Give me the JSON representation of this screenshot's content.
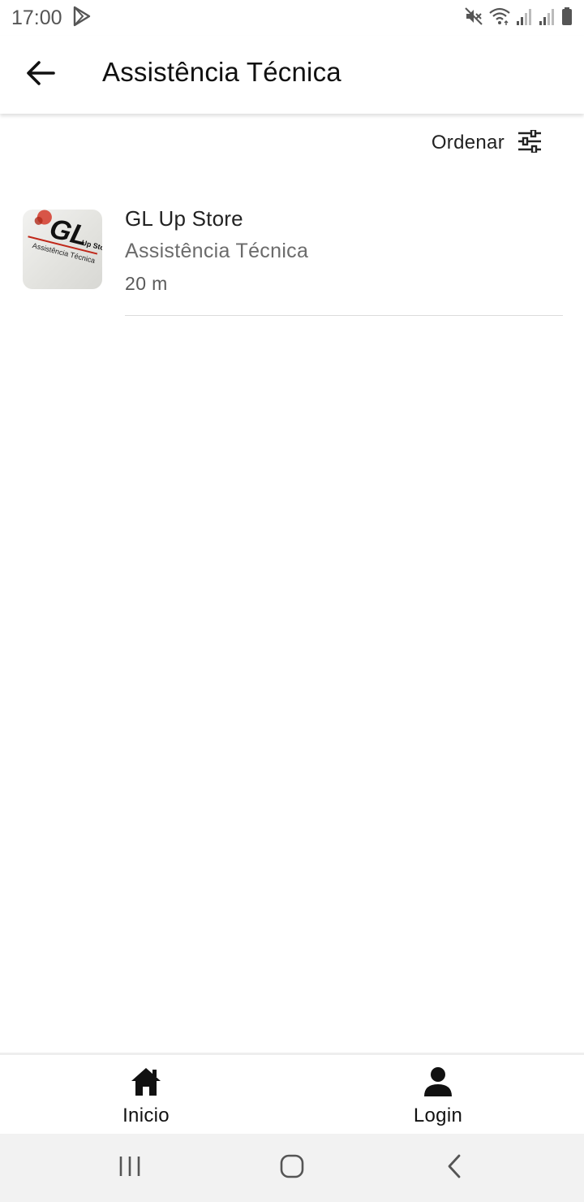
{
  "status_bar": {
    "time": "17:00",
    "icons": [
      "play-store-icon",
      "mute-icon",
      "wifi-icon",
      "signal-icon",
      "signal-icon",
      "battery-icon"
    ]
  },
  "app_bar": {
    "title": "Assistência Técnica",
    "back_icon": "arrow-left-icon"
  },
  "sort": {
    "label": "Ordenar",
    "icon": "sliders-icon"
  },
  "list": {
    "items": [
      {
        "name": "GL Up Store",
        "category": "Assistência Técnica",
        "distance": "20 m",
        "logo": {
          "text": "GL",
          "subtext": "Up Store",
          "tagline": "Assistência Técnica"
        }
      }
    ]
  },
  "bottom_nav": {
    "items": [
      {
        "label": "Inicio",
        "icon": "home-icon"
      },
      {
        "label": "Login",
        "icon": "person-icon"
      }
    ]
  },
  "system_nav": {
    "icons": [
      "recents-icon",
      "home-circle-icon",
      "back-chevron-icon"
    ]
  },
  "colors": {
    "background": "#ffffff",
    "text_primary": "#222222",
    "text_secondary": "#6b6b6b",
    "divider": "#dcdcdc",
    "system_nav_bg": "#f2f2f2"
  }
}
